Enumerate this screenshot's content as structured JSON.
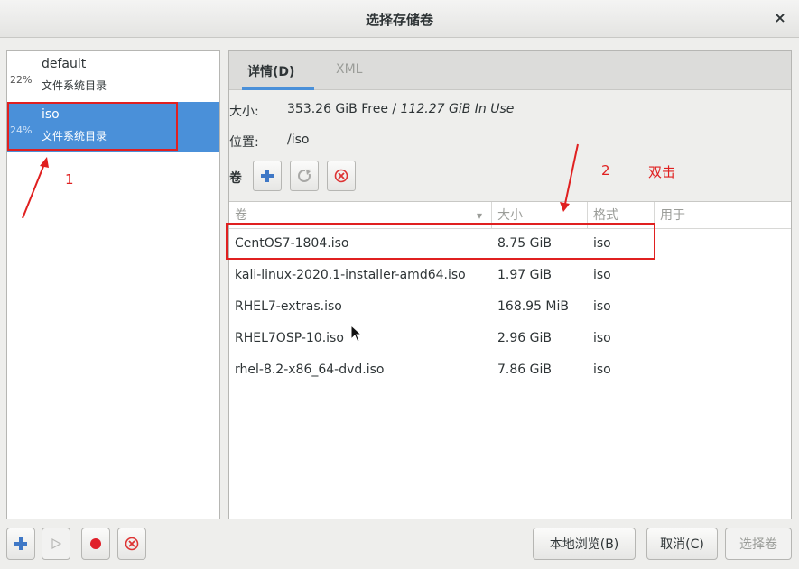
{
  "window": {
    "title": "选择存储卷",
    "close_glyph": "×"
  },
  "pools": [
    {
      "percent": "22%",
      "name": "default",
      "type": "文件系统目录",
      "selected": false
    },
    {
      "percent": "24%",
      "name": "iso",
      "type": "文件系统目录",
      "selected": true
    }
  ],
  "tabs": {
    "details": "详情(D)",
    "xml": "XML"
  },
  "details": {
    "size_label": "大小:",
    "size_free": "353.26 GiB Free",
    "size_sep": " / ",
    "size_in_use": "112.27 GiB In Use",
    "location_label": "位置:",
    "location_value": "/iso"
  },
  "volumes_toolbar": {
    "label": "卷"
  },
  "table": {
    "columns": {
      "volume": "卷",
      "size": "大小",
      "format": "格式",
      "used_by": "用于"
    },
    "sort_glyph": "▾",
    "rows": [
      {
        "name": "CentOS7-1804.iso",
        "size": "8.75 GiB",
        "format": "iso",
        "used_by": ""
      },
      {
        "name": "kali-linux-2020.1-installer-amd64.iso",
        "size": "1.97 GiB",
        "format": "iso",
        "used_by": ""
      },
      {
        "name": "RHEL7-extras.iso",
        "size": "168.95 MiB",
        "format": "iso",
        "used_by": ""
      },
      {
        "name": "RHEL7OSP-10.iso",
        "size": "2.96 GiB",
        "format": "iso",
        "used_by": ""
      },
      {
        "name": "rhel-8.2-x86_64-dvd.iso",
        "size": "7.86 GiB",
        "format": "iso",
        "used_by": ""
      }
    ]
  },
  "buttons": {
    "browse_local": "本地浏览(B)",
    "cancel": "取消(C)",
    "choose_volume": "选择卷"
  },
  "annotations": {
    "step1": "1",
    "step2": "2",
    "step2_text": "双击",
    "color": "#e02020"
  },
  "colors": {
    "accent": "#4a90d9",
    "add_icon": "#3f78c6",
    "stop_red": "#e0202a",
    "delete_red": "#d33"
  }
}
